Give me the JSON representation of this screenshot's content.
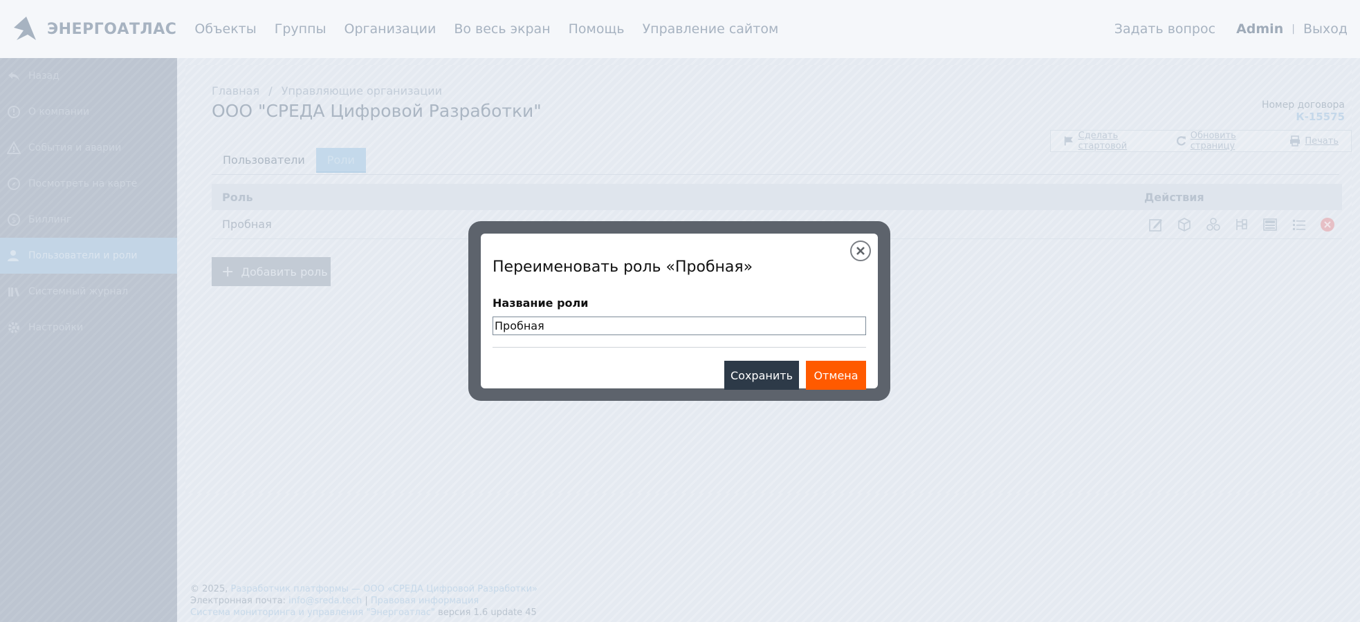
{
  "header": {
    "logo_text": "ЭНЕРГОАТЛАС",
    "nav": [
      "Объекты",
      "Группы",
      "Организации",
      "Во весь экран",
      "Помощь",
      "Управление сайтом"
    ],
    "ask": "Задать вопрос",
    "user": "Admin",
    "separator": "|",
    "logout": "Выход"
  },
  "sidebar": {
    "items": [
      {
        "label": "Назад",
        "icon": "back-arrow-icon"
      },
      {
        "label": "О компании",
        "icon": "info-icon"
      },
      {
        "label": "События и аварии",
        "icon": "warning-icon"
      },
      {
        "label": "Посмотреть на карте",
        "icon": "compass-icon"
      },
      {
        "label": "Биллинг",
        "icon": "dollar-icon"
      },
      {
        "label": "Пользователи и роли",
        "icon": "users-icon",
        "active": true
      },
      {
        "label": "Системный журнал",
        "icon": "books-icon"
      },
      {
        "label": "Настройки",
        "icon": "gear-icon"
      }
    ]
  },
  "main": {
    "breadcrumb": [
      "Главная",
      "Управляющие организации"
    ],
    "breadcrumb_sep": "/",
    "title": "ООО \"СРЕДА Цифровой Разработки\"",
    "contract_label": "Номер договора",
    "contract_number": "К-15575",
    "toolbar": {
      "make_start": "Сделать стартовой",
      "refresh": "Обновить страницу",
      "print": "Печать"
    },
    "tabs": [
      "Пользователи",
      "Роли"
    ],
    "active_tab": "Роли",
    "table": {
      "headers": [
        "Роль",
        "Действия"
      ],
      "rows": [
        {
          "role": "Пробная"
        }
      ]
    },
    "add_role": "Добавить роль",
    "add_role_plus": "+"
  },
  "footer": {
    "copyright": "© 2025,",
    "developer_link": "Разработчик платформы — ООО «СРЕДА Цифровой Разработки»",
    "email_label": "Электронная почта:",
    "email": "info@sreda.tech",
    "sep": "|",
    "legal": "Правовая информация",
    "system_link": "Система мониторинга и управления \"Энергоатлас\"",
    "version": "версия 1.6 update 45"
  },
  "modal": {
    "title": "Переименовать роль «Пробная»",
    "field_label": "Название роли",
    "field_value": "Пробная",
    "save": "Сохранить",
    "cancel": "Отмена"
  },
  "colors": {
    "save_button": "#2d3a48",
    "cancel_button": "#ff5a00",
    "modal_frame": "#5d636c"
  }
}
